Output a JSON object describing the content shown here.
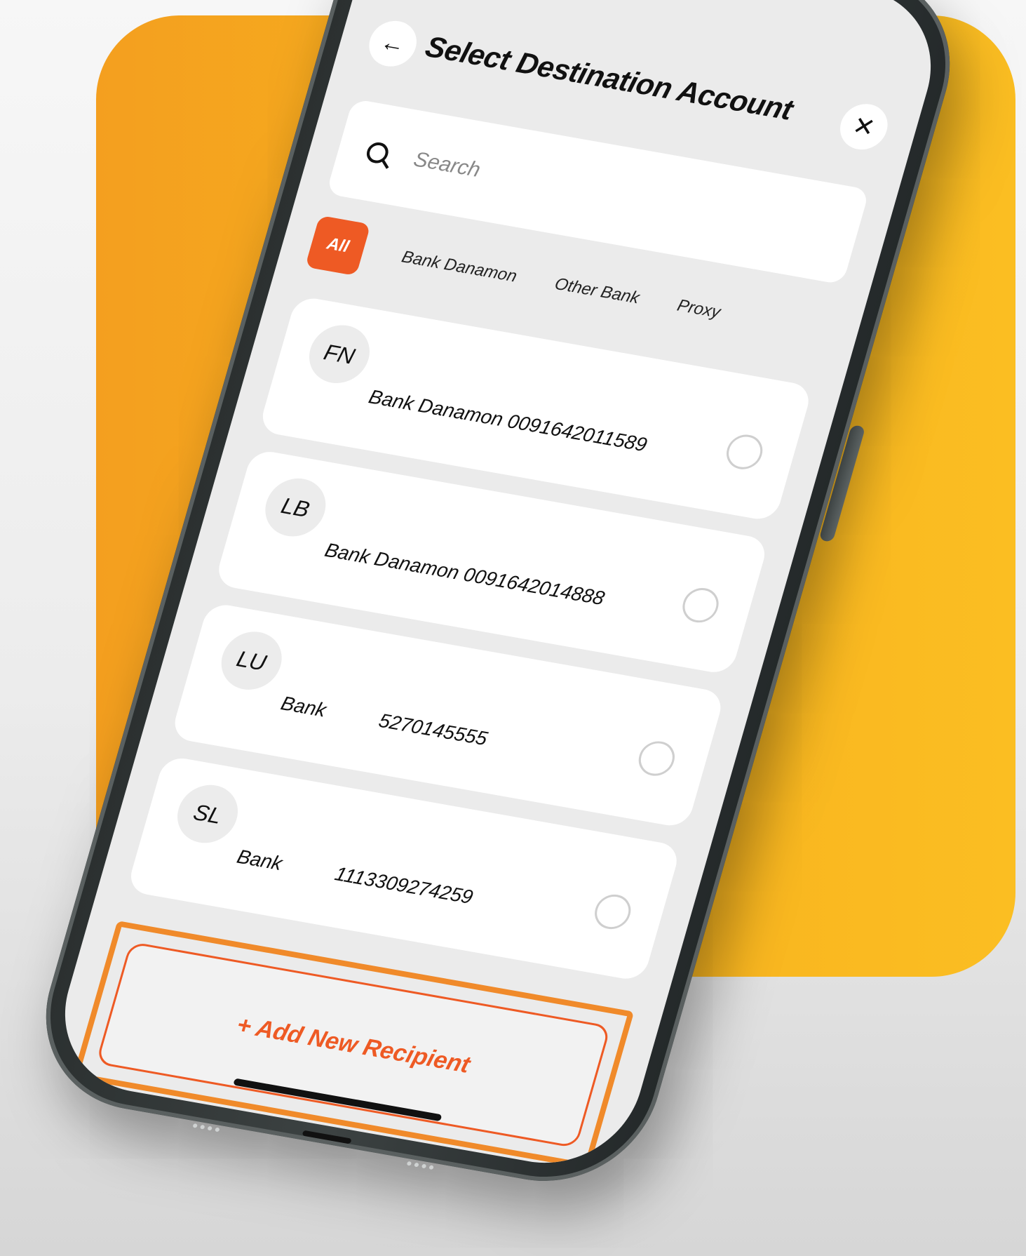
{
  "header": {
    "back_glyph": "←",
    "title": "Select Destination Account",
    "close_glyph": "✕"
  },
  "search": {
    "placeholder": "Search"
  },
  "tabs": [
    {
      "label": "All",
      "active": true
    },
    {
      "label": "Bank Danamon",
      "active": false
    },
    {
      "label": "Other Bank",
      "active": false
    },
    {
      "label": "Proxy",
      "active": false
    }
  ],
  "recipients": [
    {
      "initials": "FN",
      "account": "Bank Danamon 0091642011589"
    },
    {
      "initials": "LB",
      "account": "Bank Danamon 0091642014888"
    },
    {
      "initials": "LU",
      "account": "Bank          5270145555"
    },
    {
      "initials": "SL",
      "account": "Bank          1113309274259"
    }
  ],
  "add_button": {
    "label": "+ Add New Recipient"
  },
  "colors": {
    "accent": "#ee5a24",
    "highlight_border": "#f08a2a",
    "backdrop_orange": "#f49f1f",
    "backdrop_yellow": "#fbbe22"
  },
  "icons": {
    "back": "arrow-left-icon",
    "close": "close-icon",
    "search": "search-icon",
    "radio": "radio-unselected-icon"
  }
}
